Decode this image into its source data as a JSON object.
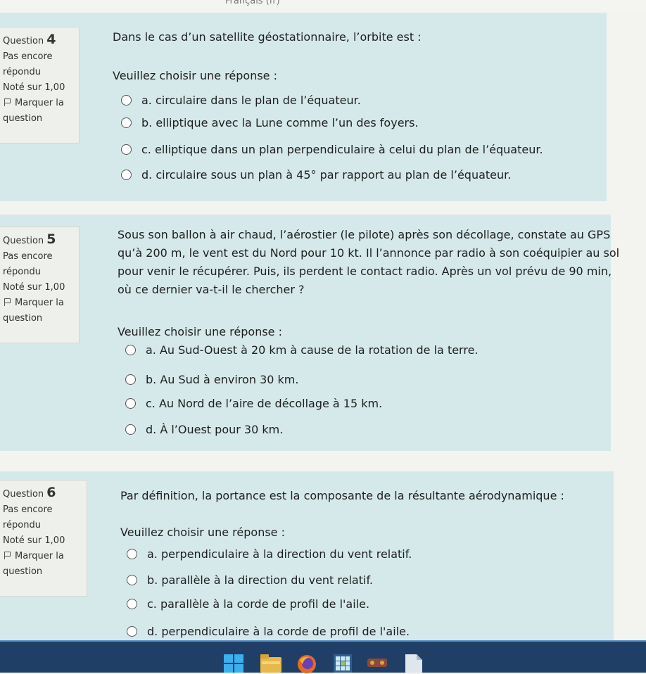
{
  "header": {
    "lang": "Français (fr)"
  },
  "questions": [
    {
      "label": "Question",
      "number": "4",
      "status1": "Pas encore",
      "status2": "répondu",
      "grade": "Noté sur 1,00",
      "flag1": "Marquer la",
      "flag2": "question",
      "text": "Dans le cas d’un satellite géostationnaire, l’orbite est :",
      "prompt": "Veuillez choisir une réponse :",
      "options": [
        "a. circulaire dans le plan de l’équateur.",
        "b. elliptique avec la Lune comme l’un des foyers.",
        "c. elliptique dans un plan perpendiculaire à celui du plan de l’équateur.",
        "d. circulaire sous un plan à 45° par rapport au plan de l’équateur."
      ]
    },
    {
      "label": "Question",
      "number": "5",
      "status1": "Pas encore",
      "status2": "répondu",
      "grade": "Noté sur 1,00",
      "flag1": "Marquer la",
      "flag2": "question",
      "text_lines": [
        "Sous son ballon à air chaud, l’aérostier (le pilote) après son décollage, constate au GPS",
        "qu’à 200 m, le vent est du Nord pour 10 kt. Il l’annonce par radio à son coéquipier au sol",
        "pour venir le récupérer. Puis, ils perdent le contact radio. Après un vol prévu de 90 min,",
        "où ce dernier va-t-il le chercher ?"
      ],
      "prompt": "Veuillez choisir une réponse :",
      "options": [
        "a. Au Sud-Ouest à 20 km à cause de la rotation de la terre.",
        "b. Au Sud à environ 30 km.",
        "c. Au Nord de l’aire de décollage à 15 km.",
        "d. À l’Ouest pour 30 km."
      ]
    },
    {
      "label": "Question",
      "number": "6",
      "status1": "Pas encore",
      "status2": "répondu",
      "grade": "Noté sur 1,00",
      "flag1": "Marquer la",
      "flag2": "question",
      "text": "Par définition, la portance est la composante de la résultante aérodynamique :",
      "prompt": "Veuillez choisir une réponse :",
      "options": [
        "a. perpendiculaire à la direction du vent relatif.",
        "b. parallèle à la direction du vent relatif.",
        "c. parallèle à la corde de profil de l'aile.",
        "d. perpendiculaire à la corde de profil de l'aile."
      ]
    }
  ],
  "taskbar": {
    "icons": [
      "windows-start-icon",
      "file-explorer-icon",
      "firefox-icon",
      "app-grid-icon",
      "game-icon",
      "document-icon"
    ],
    "colors": {
      "bar": "#1f3f66",
      "card": "#d6e9ea"
    }
  }
}
